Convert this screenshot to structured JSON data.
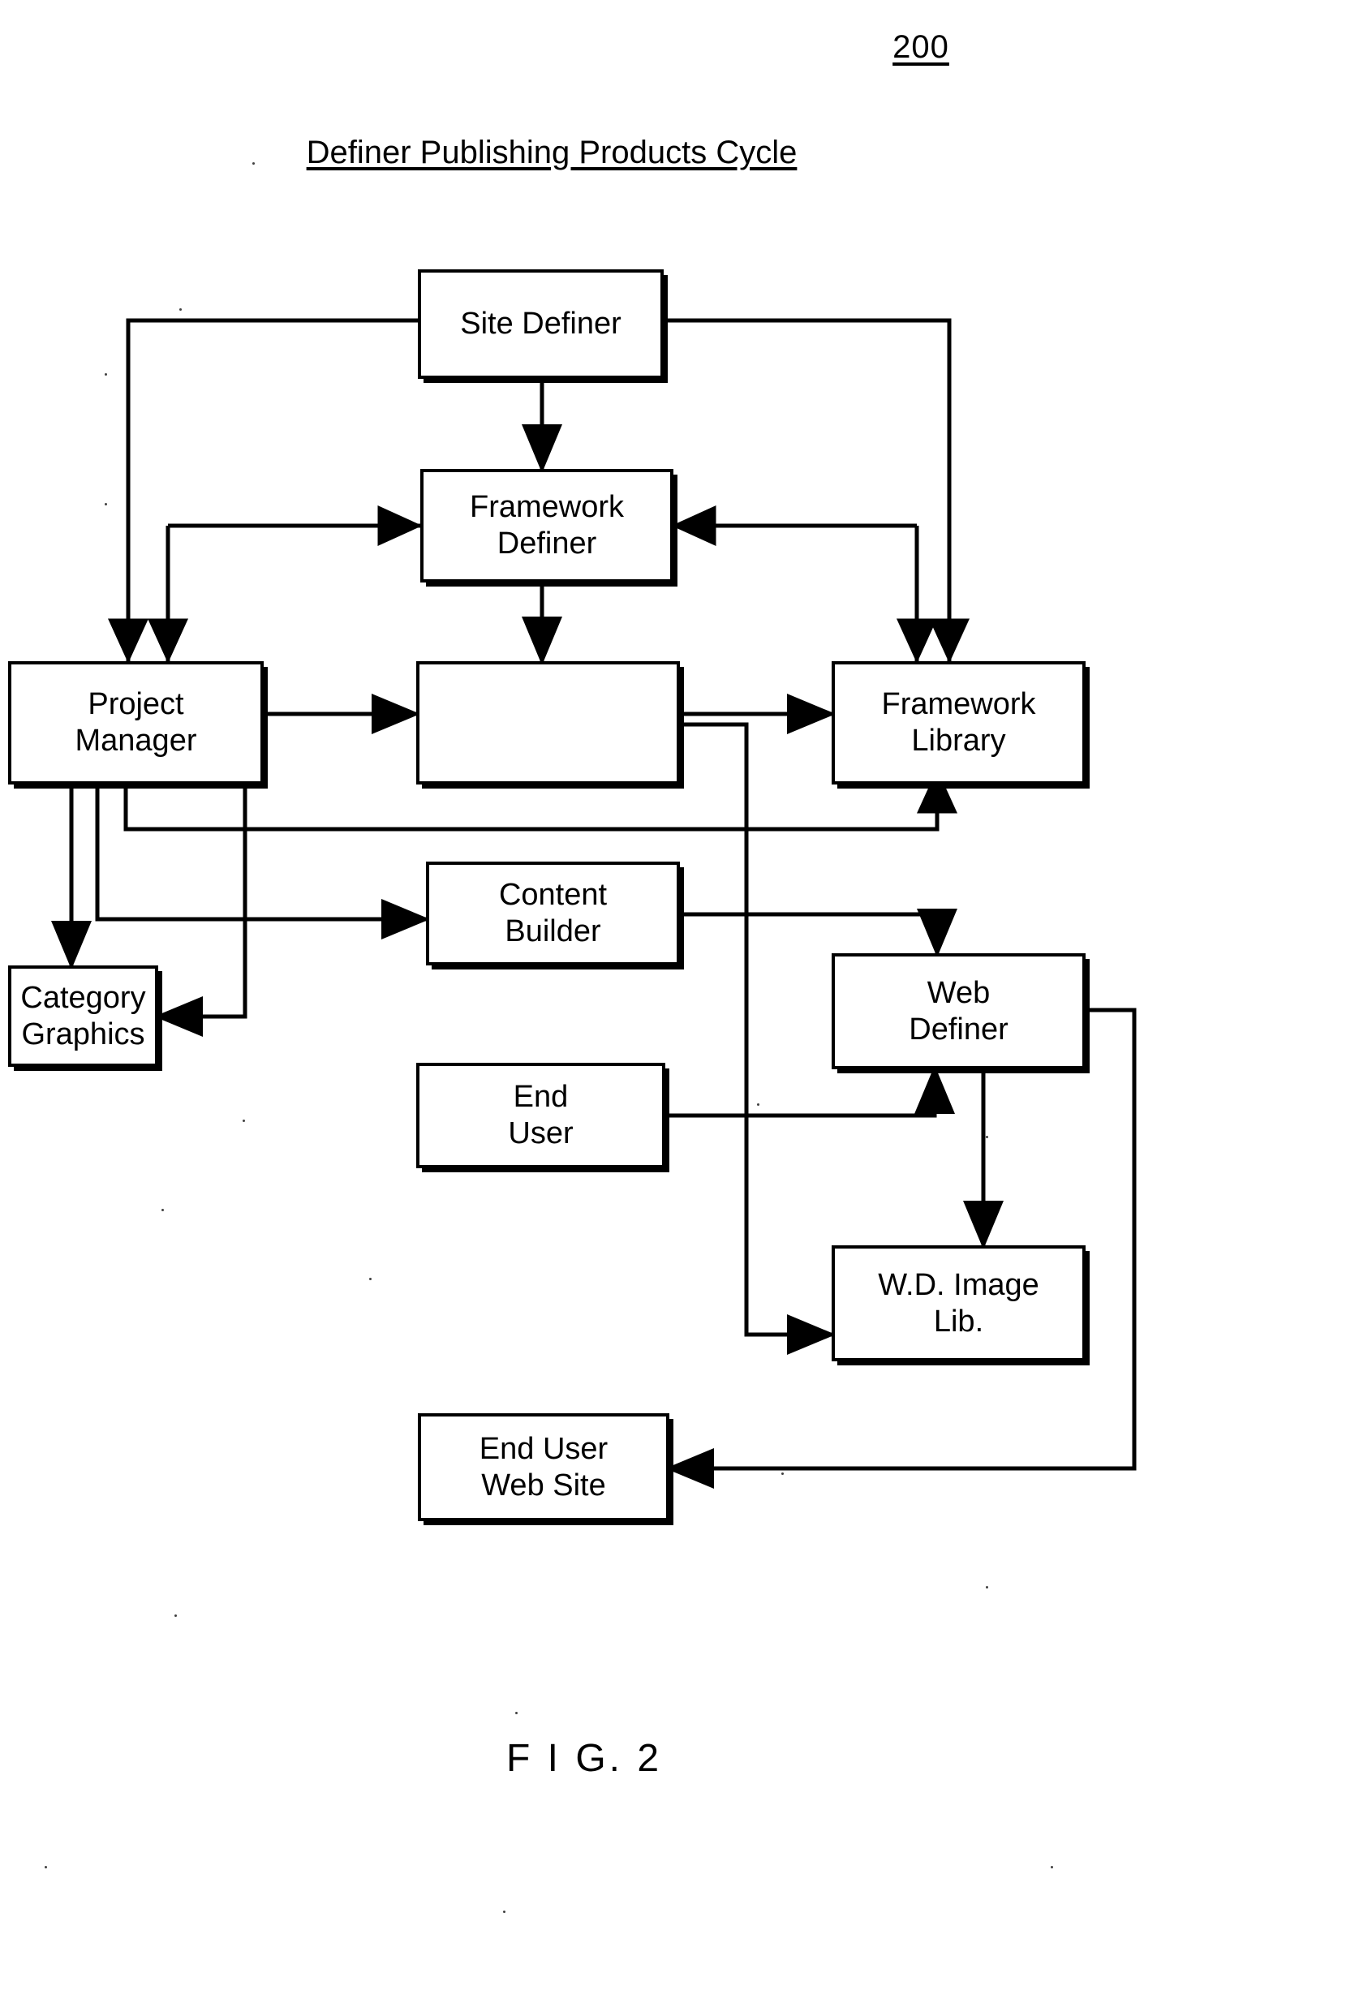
{
  "figure": {
    "reference_number": "200",
    "caption": "F I G. 2"
  },
  "diagram": {
    "title": "Definer Publishing Products Cycle",
    "type": "flowchart",
    "nodes": [
      {
        "id": "site-definer",
        "label": "Site Definer"
      },
      {
        "id": "framework-definer",
        "label": "Framework\nDefiner"
      },
      {
        "id": "project-manager",
        "label": "Project\nManager"
      },
      {
        "id": "center-unlabeled",
        "label": ""
      },
      {
        "id": "framework-library",
        "label": "Framework\nLibrary"
      },
      {
        "id": "content-builder",
        "label": "Content\nBuilder"
      },
      {
        "id": "category-graphics",
        "label": "Category\nGraphics"
      },
      {
        "id": "web-definer",
        "label": "Web\nDefiner"
      },
      {
        "id": "end-user",
        "label": "End\nUser"
      },
      {
        "id": "wd-image-lib",
        "label": "W.D. Image\nLib."
      },
      {
        "id": "end-user-web-site",
        "label": "End User\nWeb Site"
      }
    ],
    "edges": [
      {
        "from": "site-definer",
        "to": "project-manager",
        "arrow": "single"
      },
      {
        "from": "site-definer",
        "to": "framework-definer",
        "arrow": "single"
      },
      {
        "from": "site-definer",
        "to": "framework-library",
        "arrow": "single"
      },
      {
        "from": "framework-definer",
        "to": "center-unlabeled",
        "arrow": "single"
      },
      {
        "from": "project-manager",
        "to": "center-unlabeled",
        "arrow": "double"
      },
      {
        "from": "center-unlabeled",
        "to": "framework-library",
        "arrow": "double"
      },
      {
        "from": "framework-library",
        "to": "framework-definer",
        "arrow": "single"
      },
      {
        "from": "project-manager",
        "to": "category-graphics",
        "arrow": "double"
      },
      {
        "from": "project-manager",
        "to": "content-builder",
        "arrow": "single"
      },
      {
        "from": "project-manager",
        "to": "framework-library",
        "arrow": "single"
      },
      {
        "from": "category-graphics",
        "to": "center-unlabeled",
        "arrow": "single"
      },
      {
        "from": "content-builder",
        "to": "web-definer",
        "arrow": "single"
      },
      {
        "from": "end-user",
        "to": "web-definer",
        "arrow": "single"
      },
      {
        "from": "web-definer",
        "to": "wd-image-lib",
        "arrow": "double"
      },
      {
        "from": "center-unlabeled",
        "to": "wd-image-lib",
        "arrow": "single"
      },
      {
        "from": "web-definer",
        "to": "end-user-web-site",
        "arrow": "single"
      }
    ]
  }
}
